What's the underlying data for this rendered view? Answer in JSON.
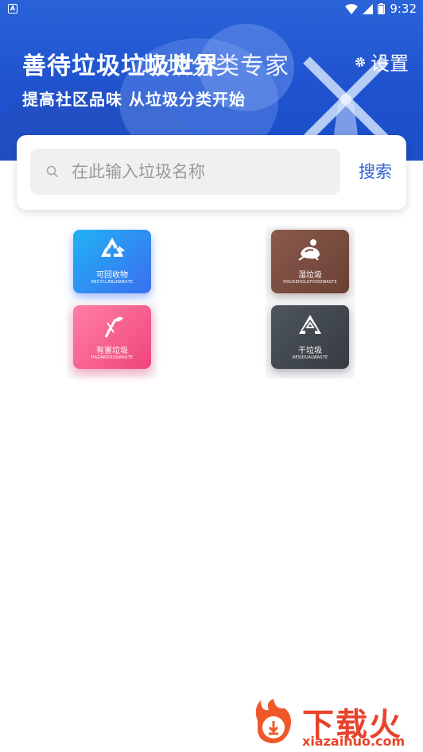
{
  "status": {
    "left_icon": "A",
    "time": "9:32",
    "icons": [
      "wifi-icon",
      "signal-icon",
      "battery-icon"
    ]
  },
  "header": {
    "title": "善待垃圾垃圾世界",
    "title_overlay": "垃圾分类专家",
    "subtitle": "提高社区品味 从垃圾分类开始",
    "settings_label": "设置"
  },
  "search": {
    "placeholder": "在此输入垃圾名称",
    "button_label": "搜索"
  },
  "categories": [
    {
      "name": "可回收物",
      "sub": "RECYCLABLEWASTE",
      "color": "#2b8ff2"
    },
    {
      "name": "湿垃圾",
      "sub": "HOUSEHOLDFOODWASTE",
      "color": "#7a4c40"
    },
    {
      "name": "有害垃圾",
      "sub": "HAZARDOUSWASTE",
      "color": "#f25a88"
    },
    {
      "name": "干垃圾",
      "sub": "RESIDUALWASTE",
      "color": "#43494f"
    }
  ],
  "watermark": {
    "brand": "下载火",
    "url": "xiazaihuo.com"
  }
}
